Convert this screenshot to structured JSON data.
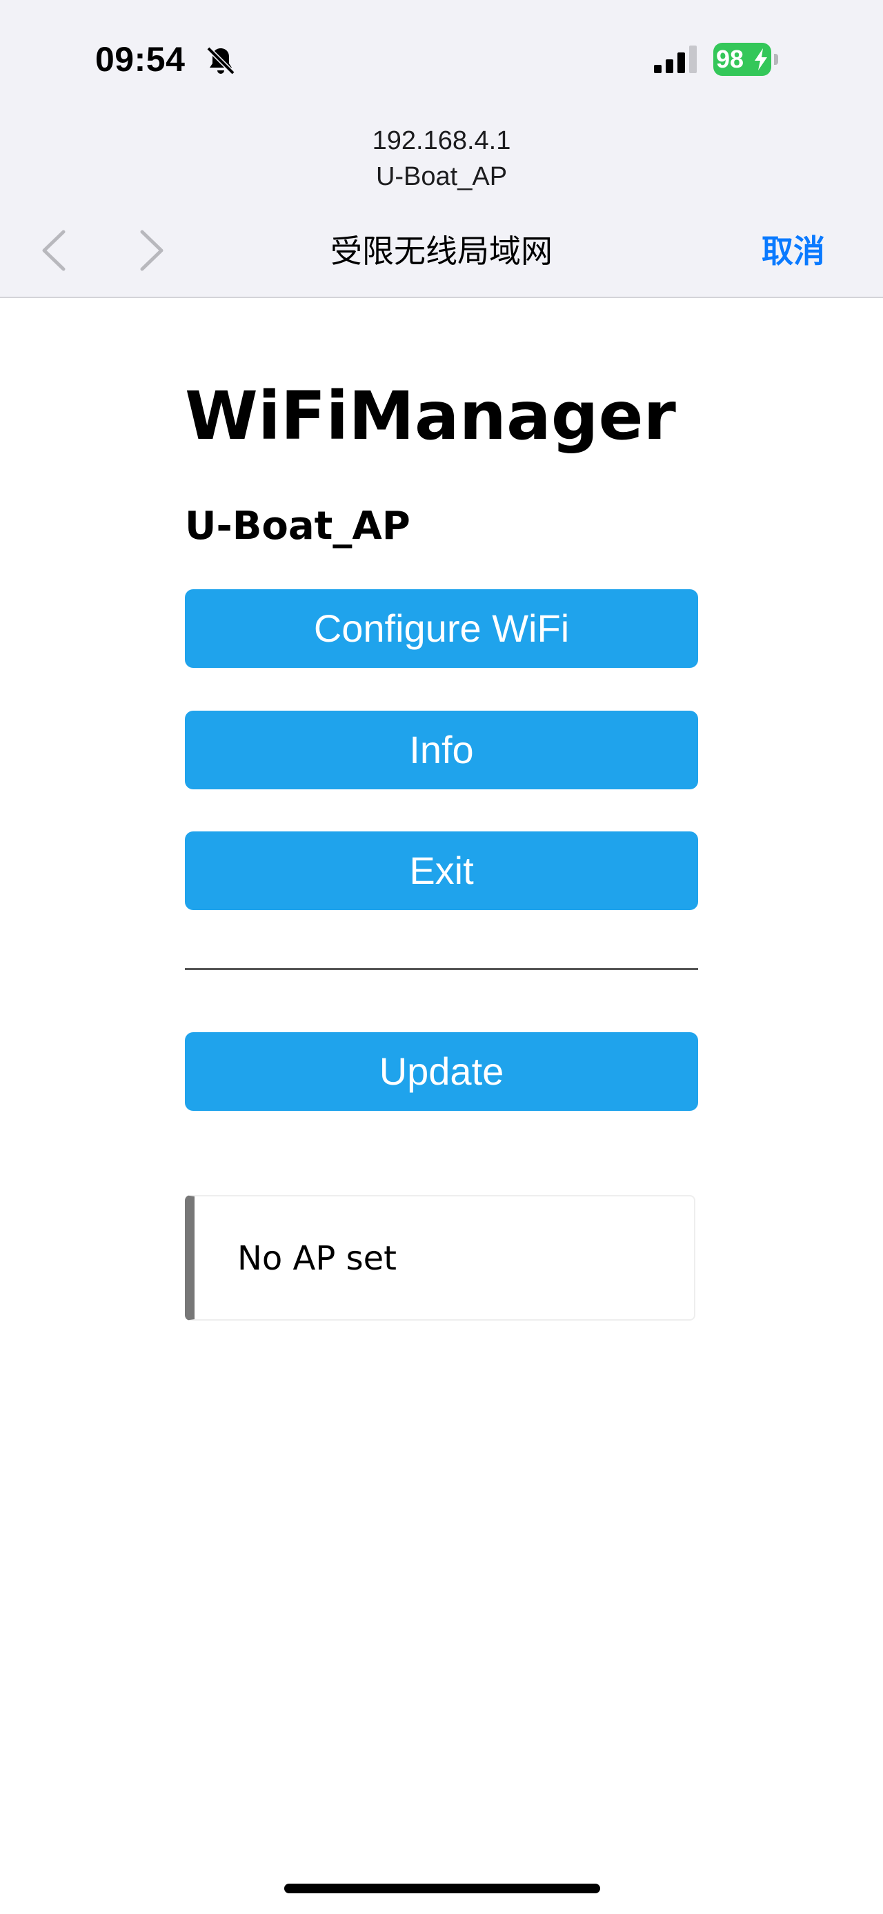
{
  "status_bar": {
    "time": "09:54",
    "battery_percent": "98",
    "icons": [
      "bell-slash-icon",
      "cellular-signal-icon",
      "battery-charging-icon"
    ],
    "battery_color": "#34c759"
  },
  "captive_header": {
    "ip": "192.168.4.1",
    "ssid": "U-Boat_AP",
    "title": "受限无线局域网",
    "cancel_label": "取消",
    "icons": [
      "chevron-left-icon",
      "chevron-right-icon"
    ],
    "accent_color": "#0a7aff"
  },
  "page": {
    "title": "WiFiManager",
    "ap_name": "U-Boat_AP",
    "buttons": {
      "configure_wifi": "Configure WiFi",
      "info": "Info",
      "exit": "Exit",
      "update": "Update"
    },
    "button_color": "#1fa3ec",
    "message": "No AP set"
  }
}
